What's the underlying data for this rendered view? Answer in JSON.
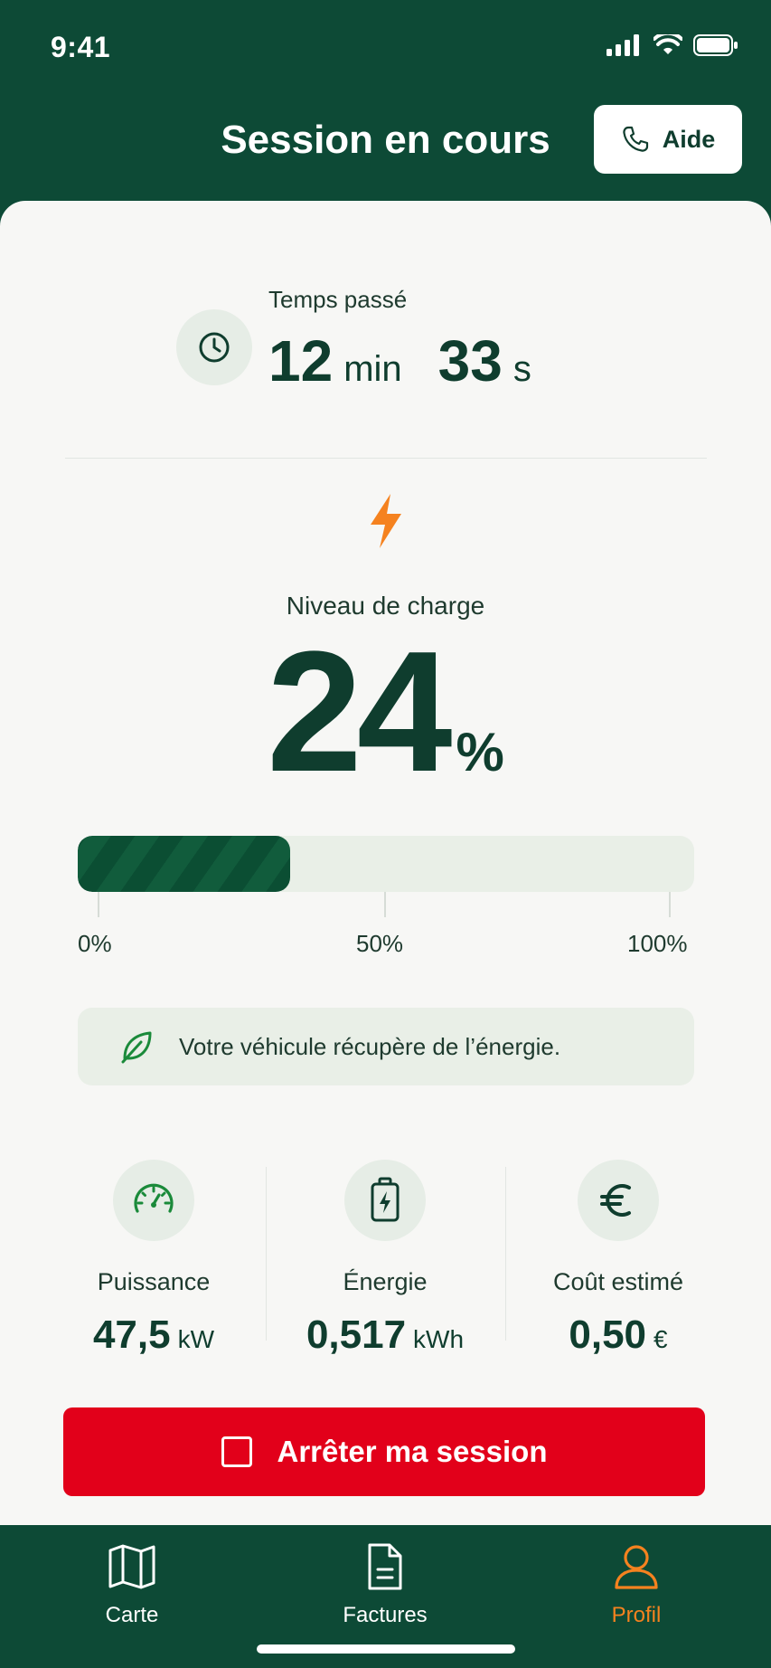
{
  "status_bar": {
    "time": "9:41"
  },
  "header": {
    "title": "Session en cours",
    "help_label": "Aide"
  },
  "timer": {
    "label": "Temps passé",
    "minutes": "12",
    "minutes_unit": "min",
    "seconds": "33",
    "seconds_unit": "s"
  },
  "charge": {
    "label": "Niveau de charge",
    "value": "24",
    "unit": "%",
    "progress_fraction": 0.345,
    "scale": [
      "0%",
      "50%",
      "100%"
    ]
  },
  "info": {
    "message": "Votre véhicule récupère de l’énergie."
  },
  "stats": [
    {
      "icon": "speedometer-icon",
      "label": "Puissance",
      "value": "47,5",
      "unit": "kW"
    },
    {
      "icon": "battery-charging-icon",
      "label": "Énergie",
      "value": "0,517",
      "unit": "kWh"
    },
    {
      "icon": "euro-icon",
      "label": "Coût estimé",
      "value": "0,50",
      "unit": "€"
    }
  ],
  "stop_button": {
    "label": "Arrêter ma session"
  },
  "tabs": [
    {
      "icon": "map-icon",
      "label": "Carte",
      "active": false
    },
    {
      "icon": "document-icon",
      "label": "Factures",
      "active": false
    },
    {
      "icon": "profile-icon",
      "label": "Profil",
      "active": true
    }
  ],
  "colors": {
    "primary": "#0d4a36",
    "accent": "#f5821f",
    "danger": "#e2001a",
    "surface": "#f7f7f5",
    "tint": "#e9efe7"
  }
}
